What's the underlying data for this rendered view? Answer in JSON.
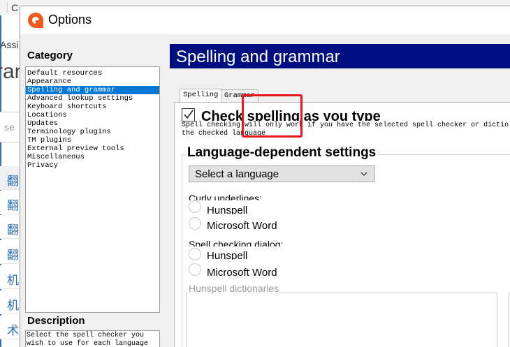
{
  "background": {
    "top_fragments": [
      "C",
      "",
      "",
      "",
      ""
    ],
    "assi": "Assi",
    "ran": "ran",
    "search_placeholder": "se",
    "rows": [
      "翻",
      "翻",
      "翻",
      "翻",
      "机",
      "机",
      "术"
    ]
  },
  "dialog": {
    "title": "Options",
    "category_label": "Category",
    "categories": [
      {
        "label": "Default resources",
        "selected": false
      },
      {
        "label": "Appearance",
        "selected": false
      },
      {
        "label": "Spelling and grammar",
        "selected": true
      },
      {
        "label": "Advanced lookup settings",
        "selected": false
      },
      {
        "label": "Keyboard shortcuts",
        "selected": false
      },
      {
        "label": "Locations",
        "selected": false
      },
      {
        "label": "Updates",
        "selected": false
      },
      {
        "label": "Terminology plugins",
        "selected": false
      },
      {
        "label": "TM plugins",
        "selected": false
      },
      {
        "label": "External preview tools",
        "selected": false
      },
      {
        "label": "Miscellaneous",
        "selected": false
      },
      {
        "label": "Privacy",
        "selected": false
      }
    ],
    "description_label": "Description",
    "description_text": "Select the spell checker you wish to use for each language",
    "heading": "Spelling and grammar",
    "tabs": [
      {
        "label": "Spelling",
        "active": true
      },
      {
        "label": "Grammar",
        "active": false
      }
    ],
    "spelling": {
      "check_spelling_label": "Check spelling as you type",
      "check_spelling_checked": true,
      "info_line1": "Spell checking will only work if you have the selected spell checker or dictio",
      "info_line2": "the checked language",
      "group_title": "Language-dependent settings",
      "language_select": "Select a language",
      "curly_label": "Curly underlines:",
      "curly_options": [
        "Hunspell",
        "Microsoft Word"
      ],
      "dialog_label": "Spell checking dialog:",
      "dialog_options": [
        "Hunspell",
        "Microsoft Word"
      ],
      "hunspell_label": "Hunspell dictionaries"
    }
  },
  "colors": {
    "heading_bg": "#000f80",
    "selection": "#0078d7",
    "highlight": "#e8151d",
    "app_icon": "#f05a1e"
  }
}
